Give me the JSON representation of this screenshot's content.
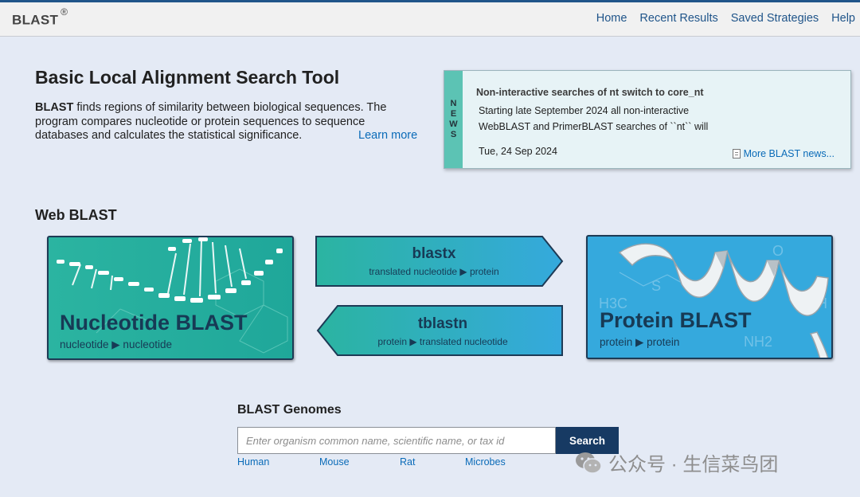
{
  "header": {
    "logo": "BLAST",
    "logo_mark": "®",
    "nav": [
      "Home",
      "Recent Results",
      "Saved Strategies",
      "Help"
    ]
  },
  "intro": {
    "title": "Basic Local Alignment Search Tool",
    "lead_bold": "BLAST",
    "lead_text": " finds regions of similarity between biological sequences. The program compares nucleotide or protein sequences to sequence databases and calculates the statistical significance.",
    "learn_more": "Learn more"
  },
  "news": {
    "tab_letters": [
      "N",
      "E",
      "W",
      "S"
    ],
    "headline": "Non-interactive searches of nt switch to core_nt",
    "body": "Starting late September 2024 all non-interactive WebBLAST and PrimerBLAST searches of ``nt`` will",
    "date": "Tue, 24 Sep 2024",
    "more_link": "More BLAST news..."
  },
  "web_blast": {
    "title": "Web BLAST",
    "nucleotide": {
      "title": "Nucleotide BLAST",
      "subtitle": "nucleotide ▶ nucleotide"
    },
    "blastx": {
      "title": "blastx",
      "subtitle": "translated nucleotide ▶ protein"
    },
    "tblastn": {
      "title": "tblastn",
      "subtitle": "protein ▶ translated nucleotide"
    },
    "protein": {
      "title": "Protein BLAST",
      "subtitle": "protein ▶ protein"
    }
  },
  "genomes": {
    "title": "BLAST Genomes",
    "placeholder": "Enter organism common name, scientific name, or tax id",
    "search_label": "Search",
    "organisms": [
      "Human",
      "Mouse",
      "Rat",
      "Microbes"
    ]
  },
  "watermark": {
    "text": "公众号 · 生信菜鸟团"
  },
  "colors": {
    "header_accent": "#20558a",
    "link": "#0a6bb8",
    "nucleotide_card": "#2bb4a1",
    "protein_card": "#35a9dd",
    "search_button": "#173a63"
  }
}
